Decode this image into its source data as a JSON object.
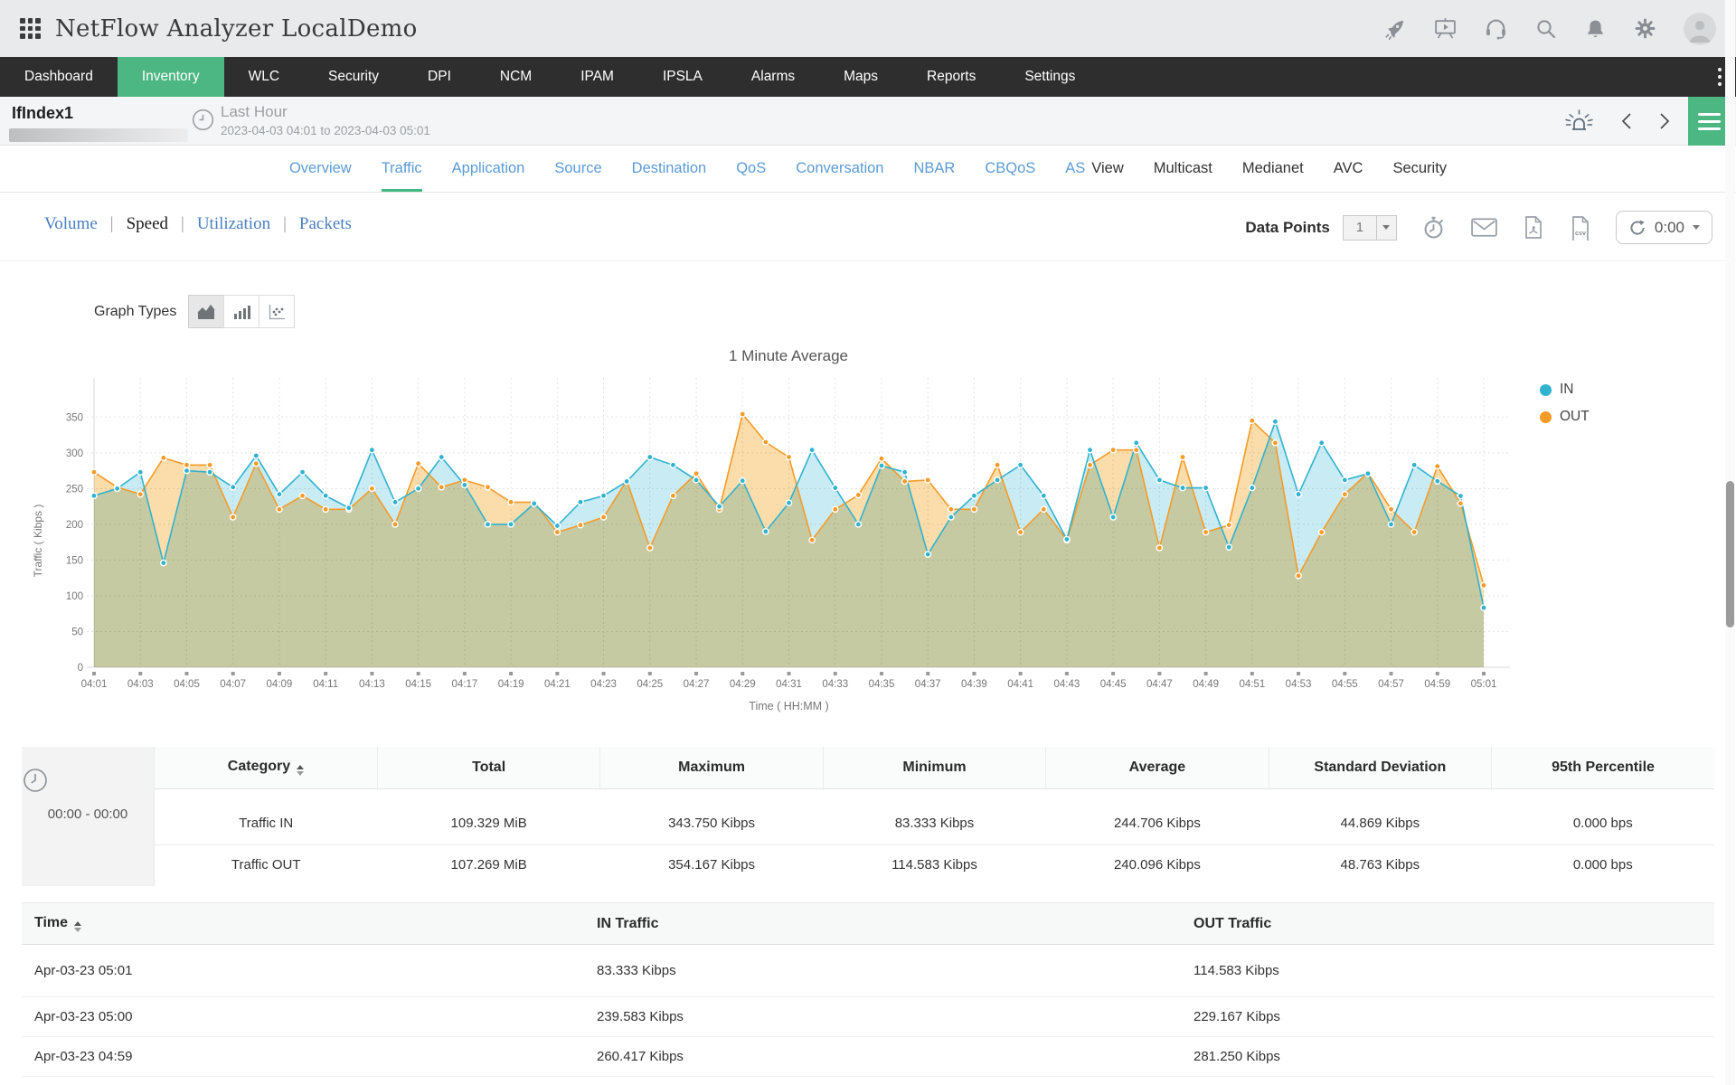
{
  "topbar": {
    "title": "NetFlow Analyzer LocalDemo",
    "icons": [
      "grid-menu",
      "rocket",
      "demo-player",
      "support-headset",
      "search",
      "notifications",
      "settings-gear",
      "user-avatar"
    ]
  },
  "nav": {
    "items": [
      "Dashboard",
      "Inventory",
      "WLC",
      "Security",
      "DPI",
      "NCM",
      "IPAM",
      "IPSLA",
      "Alarms",
      "Maps",
      "Reports",
      "Settings"
    ],
    "active": "Inventory",
    "active_color": "#4cb783"
  },
  "subheader": {
    "device": "IfIndex1",
    "period": "Last Hour",
    "range": "2023-04-03 04:01 to 2023-04-03 05:01",
    "icons": [
      "clock",
      "alarm",
      "prev-chevron",
      "next-chevron",
      "hamburger-menu"
    ]
  },
  "tabs": {
    "active": "Traffic",
    "items": [
      {
        "label": "Overview",
        "link": true
      },
      {
        "label": "Traffic",
        "link": true
      },
      {
        "label": "Application",
        "link": true
      },
      {
        "label": "Source",
        "link": true
      },
      {
        "label": "Destination",
        "link": true
      },
      {
        "label": "QoS",
        "link": true
      },
      {
        "label": "Conversation",
        "link": true
      },
      {
        "label": "NBAR",
        "link": true
      },
      {
        "label": "CBQoS",
        "link": true
      },
      {
        "label": "AS",
        "link": true
      },
      {
        "label": "View",
        "link": false
      },
      {
        "label": "Multicast",
        "link": false
      },
      {
        "label": "Medianet",
        "link": false
      },
      {
        "label": "AVC",
        "link": false
      },
      {
        "label": "Security",
        "link": false
      }
    ]
  },
  "toolbar": {
    "links": [
      "Volume",
      "Speed",
      "Utilization",
      "Packets"
    ],
    "active_link": "Speed",
    "data_points_label": "Data Points",
    "data_points_value": "1",
    "refresh_value": "0:00",
    "icons": [
      "schedule",
      "email",
      "pdf-export",
      "csv-export",
      "auto-refresh"
    ]
  },
  "graph": {
    "types_label": "Graph Types",
    "type_options": [
      "area",
      "bar",
      "scatter"
    ],
    "active_type": "area"
  },
  "chart_data": {
    "type": "area",
    "title": "1 Minute Average",
    "xlabel": "Time ( HH:MM )",
    "ylabel": "Traffic ( Kibps )",
    "ylim": [
      0,
      350
    ],
    "ytick_step": 50,
    "x_tick_every": 2,
    "grid": true,
    "legend_position": "right",
    "x": [
      "04:01",
      "04:02",
      "04:03",
      "04:04",
      "04:05",
      "04:06",
      "04:07",
      "04:08",
      "04:09",
      "04:10",
      "04:11",
      "04:12",
      "04:13",
      "04:14",
      "04:15",
      "04:16",
      "04:17",
      "04:18",
      "04:19",
      "04:20",
      "04:21",
      "04:22",
      "04:23",
      "04:24",
      "04:25",
      "04:26",
      "04:27",
      "04:28",
      "04:29",
      "04:30",
      "04:31",
      "04:32",
      "04:33",
      "04:34",
      "04:35",
      "04:36",
      "04:37",
      "04:38",
      "04:39",
      "04:40",
      "04:41",
      "04:42",
      "04:43",
      "04:44",
      "04:45",
      "04:46",
      "04:47",
      "04:48",
      "04:49",
      "04:50",
      "04:51",
      "04:52",
      "04:53",
      "04:54",
      "04:55",
      "04:56",
      "04:57",
      "04:58",
      "04:59",
      "05:00",
      "05:01"
    ],
    "series": [
      {
        "name": "IN",
        "color": "#2fb3cf",
        "fill": "#c9ebf4",
        "values": [
          240,
          250,
          273,
          146,
          275,
          273,
          252,
          296,
          242,
          273,
          240,
          223,
          304,
          231,
          250,
          294,
          255,
          200,
          200,
          229,
          198,
          231,
          240,
          260,
          294,
          283,
          262,
          225,
          261,
          190,
          230,
          304,
          251,
          200,
          282,
          273,
          158,
          210,
          240,
          262,
          283,
          240,
          179,
          304,
          210,
          314,
          262,
          251,
          251,
          168,
          251,
          343.75,
          242,
          314,
          262,
          271,
          200,
          283,
          260.417,
          239.583,
          83.333
        ]
      },
      {
        "name": "OUT",
        "color": "#f59b27",
        "fill": "#fbdcab",
        "values": [
          273,
          252,
          242,
          293,
          283,
          283,
          210,
          285,
          221,
          240,
          221,
          221,
          250,
          200,
          285,
          252,
          262,
          252,
          231,
          231,
          189,
          199,
          210,
          261,
          167,
          240,
          271,
          221,
          354.167,
          315,
          294,
          178,
          221,
          241,
          292,
          260,
          262,
          221,
          221,
          283,
          189,
          221,
          178,
          283,
          304,
          304,
          167,
          294,
          189,
          199,
          345,
          314,
          128,
          189,
          242,
          272,
          221,
          189,
          281.25,
          229.167,
          114.583
        ]
      }
    ]
  },
  "summary_table": {
    "time_window": "00:00 - 00:00",
    "headers": [
      "Category",
      "Total",
      "Maximum",
      "Minimum",
      "Average",
      "Standard Deviation",
      "95th Percentile"
    ],
    "rows": [
      [
        "Traffic IN",
        "109.329 MiB",
        "343.750 Kibps",
        "83.333 Kibps",
        "244.706 Kibps",
        "44.869 Kibps",
        "0.000 bps"
      ],
      [
        "Traffic OUT",
        "107.269 MiB",
        "354.167 Kibps",
        "114.583 Kibps",
        "240.096 Kibps",
        "48.763 Kibps",
        "0.000 bps"
      ]
    ]
  },
  "traffic_table": {
    "headers": [
      "Time",
      "IN Traffic",
      "OUT Traffic"
    ],
    "rows": [
      [
        "Apr-03-23 05:01",
        "83.333 Kibps",
        "114.583 Kibps"
      ],
      [
        "Apr-03-23 05:00",
        "239.583 Kibps",
        "229.167 Kibps"
      ],
      [
        "Apr-03-23 04:59",
        "260.417 Kibps",
        "281.250 Kibps"
      ]
    ]
  },
  "colors": {
    "accent_green": "#4cb783",
    "link_blue": "#5b9bd5",
    "serif_link_blue": "#4a7fc1",
    "nav_bg": "#2e2e2e",
    "topbar_bg": "#e9eaeb",
    "in_color": "#2fb3cf",
    "out_color": "#f59b27"
  }
}
